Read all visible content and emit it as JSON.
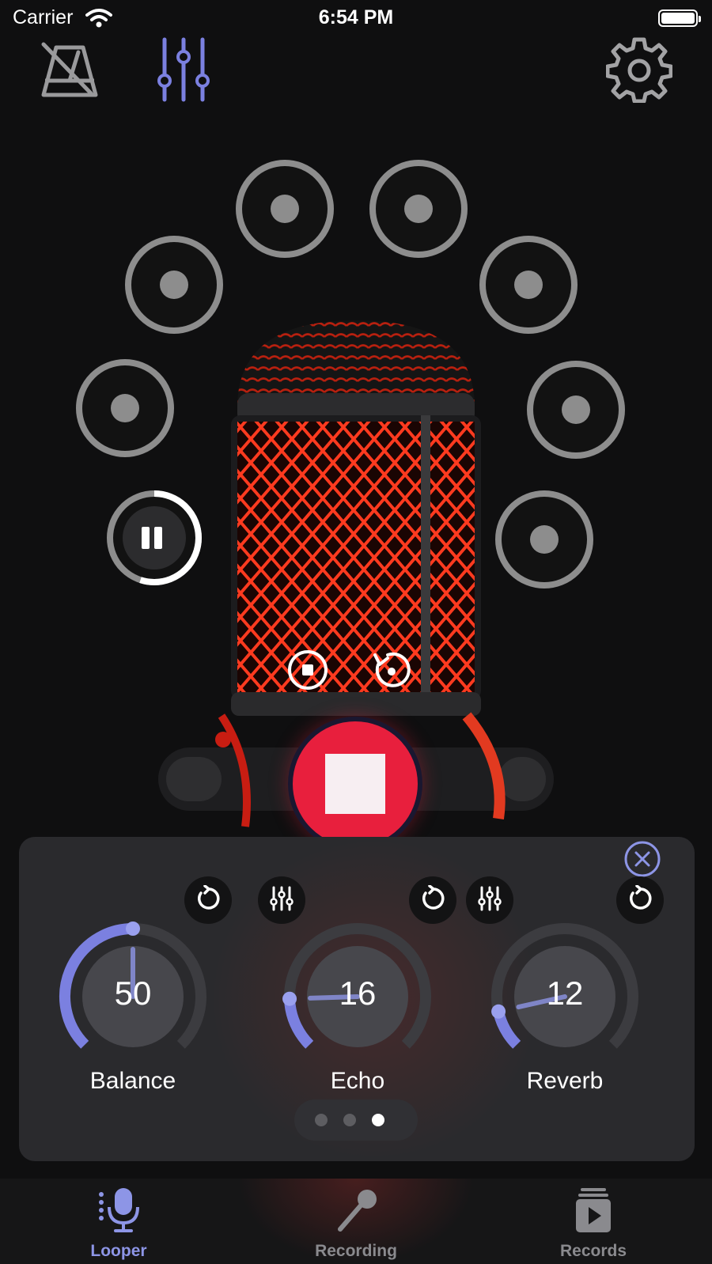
{
  "status_bar": {
    "carrier": "Carrier",
    "time": "6:54 PM"
  },
  "toolbar": {
    "metronome_icon": "metronome-muted-icon",
    "mixer_icon": "mixer-sliders-icon",
    "settings_icon": "gear-icon"
  },
  "looper": {
    "slots": [
      {
        "state": "empty"
      },
      {
        "state": "empty"
      },
      {
        "state": "empty"
      },
      {
        "state": "empty"
      },
      {
        "state": "empty"
      },
      {
        "state": "empty"
      },
      {
        "state": "empty"
      },
      {
        "state": "playing",
        "progress": 0.55
      }
    ],
    "controls": {
      "stop_icon": "stop-circle-icon",
      "undo_icon": "undo-circle-icon",
      "record_state": "recording"
    }
  },
  "effects": {
    "knobs": [
      {
        "label": "Balance",
        "value": "50",
        "fraction": 0.5
      },
      {
        "label": "Echo",
        "value": "16",
        "fraction": 0.16
      },
      {
        "label": "Reverb",
        "value": "12",
        "fraction": 0.12
      }
    ],
    "page_count": 3,
    "current_page": 3
  },
  "tabs": [
    {
      "label": "Looper",
      "icon": "microphone-icon",
      "active": true
    },
    {
      "label": "Recording",
      "icon": "handheld-mic-icon",
      "active": false
    },
    {
      "label": "Records",
      "icon": "records-play-icon",
      "active": false
    }
  ],
  "colors": {
    "accent": "#7b80e0",
    "record": "#e81f3d",
    "slot": "#8d8d8d",
    "panel": "#2a2a2d",
    "tab_inactive": "#8a8a8e"
  }
}
